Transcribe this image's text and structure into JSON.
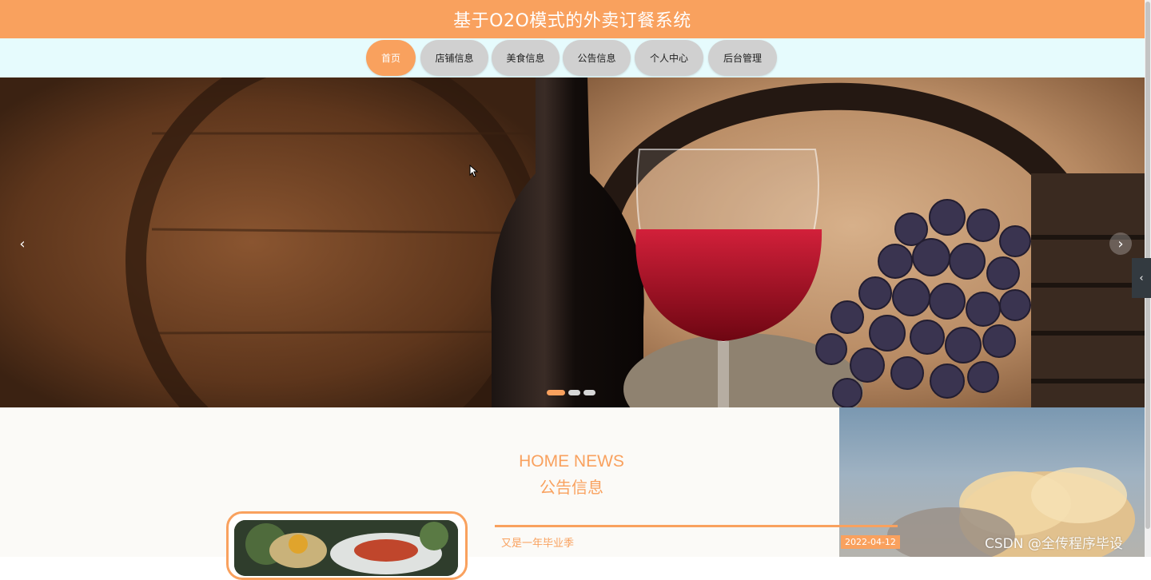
{
  "header": {
    "title": "基于O2O模式的外卖订餐系统"
  },
  "nav": {
    "items": [
      {
        "label": "首页",
        "active": true
      },
      {
        "label": "店铺信息",
        "active": false
      },
      {
        "label": "美食信息",
        "active": false
      },
      {
        "label": "公告信息",
        "active": false
      },
      {
        "label": "个人中心",
        "active": false
      },
      {
        "label": "后台管理",
        "active": false
      }
    ]
  },
  "carousel": {
    "slide_count": 3,
    "active_index": 0,
    "prev_icon": "chevron-left-icon",
    "next_icon": "chevron-right-icon"
  },
  "news": {
    "heading_en": "HOME NEWS",
    "heading_cn": "公告信息",
    "items": [
      {
        "title": "又是一年毕业季",
        "date": "2022-04-12"
      }
    ]
  },
  "watermark": "CSDN @全传程序毕设",
  "colors": {
    "accent": "#f9a15e",
    "nav_bg": "#e6fbfd",
    "nav_pill": "#d0d0d0"
  }
}
